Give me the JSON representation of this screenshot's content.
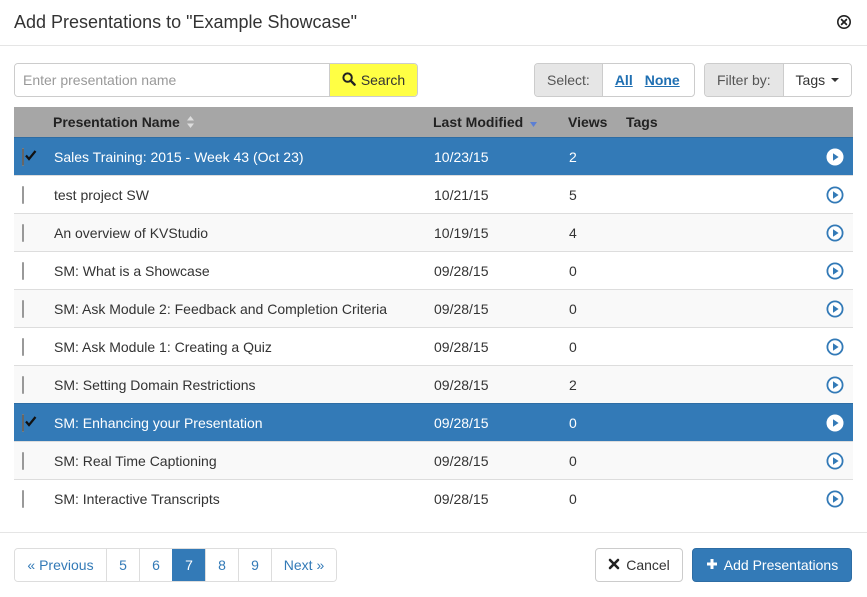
{
  "dialog": {
    "title": "Add Presentations to \"Example Showcase\"",
    "close_icon": "close-circle-icon"
  },
  "toolbar": {
    "search_placeholder": "Enter presentation name",
    "search_value": "",
    "search_label": "Search",
    "search_button_color": "#ffff44",
    "select_label": "Select:",
    "select_all": "All",
    "select_none": "None",
    "filter_label": "Filter by:",
    "tags_label": "Tags"
  },
  "table": {
    "columns": {
      "name": "Presentation Name",
      "modified": "Last Modified",
      "views": "Views",
      "tags": "Tags"
    },
    "sort_column": "Last Modified",
    "sort_direction": "descending",
    "selected_color": "#337ab7",
    "rows": [
      {
        "name": "Sales Training: 2015 - Week 43 (Oct 23)",
        "modified": "10/23/15",
        "views": "2",
        "tags": "",
        "selected": true
      },
      {
        "name": "test project SW",
        "modified": "10/21/15",
        "views": "5",
        "tags": "",
        "selected": false
      },
      {
        "name": "An overview of KVStudio",
        "modified": "10/19/15",
        "views": "4",
        "tags": "",
        "selected": false
      },
      {
        "name": "SM: What is a Showcase",
        "modified": "09/28/15",
        "views": "0",
        "tags": "",
        "selected": false
      },
      {
        "name": "SM: Ask Module 2: Feedback and Completion Criteria",
        "modified": "09/28/15",
        "views": "0",
        "tags": "",
        "selected": false
      },
      {
        "name": "SM: Ask Module 1: Creating a Quiz",
        "modified": "09/28/15",
        "views": "0",
        "tags": "",
        "selected": false
      },
      {
        "name": "SM: Setting Domain Restrictions",
        "modified": "09/28/15",
        "views": "2",
        "tags": "",
        "selected": false
      },
      {
        "name": "SM: Enhancing your Presentation",
        "modified": "09/28/15",
        "views": "0",
        "tags": "",
        "selected": true
      },
      {
        "name": "SM: Real Time Captioning",
        "modified": "09/28/15",
        "views": "0",
        "tags": "",
        "selected": false
      },
      {
        "name": "SM: Interactive Transcripts",
        "modified": "09/28/15",
        "views": "0",
        "tags": "",
        "selected": false
      }
    ]
  },
  "pagination": {
    "items": [
      {
        "label": "« Previous",
        "active": false
      },
      {
        "label": "5",
        "active": false
      },
      {
        "label": "6",
        "active": false
      },
      {
        "label": "7",
        "active": true
      },
      {
        "label": "8",
        "active": false
      },
      {
        "label": "9",
        "active": false
      },
      {
        "label": "Next »",
        "active": false
      }
    ],
    "current_page": 7
  },
  "footer": {
    "cancel_label": "Cancel",
    "add_label": "Add Presentations",
    "primary_color": "#337ab7"
  }
}
